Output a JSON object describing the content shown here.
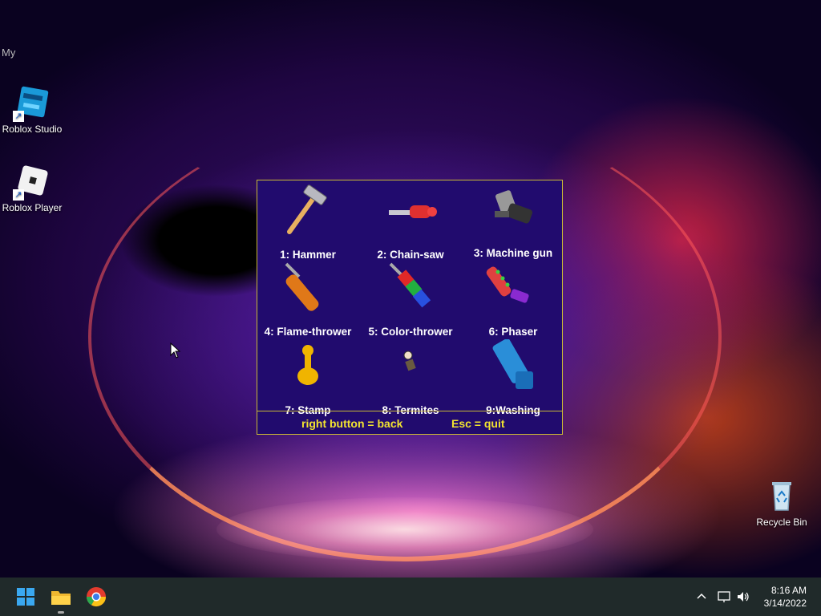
{
  "desktop": {
    "stray_text": "My",
    "icons": [
      {
        "label": "Roblox Studio",
        "icon": "roblox-studio-icon"
      },
      {
        "label": "Roblox Player",
        "icon": "roblox-player-icon"
      },
      {
        "label": "Recycle Bin",
        "icon": "recycle-bin-icon"
      }
    ]
  },
  "tool_menu": {
    "tools": [
      {
        "label": "1: Hammer",
        "icon": "hammer-icon"
      },
      {
        "label": "2: Chain-saw",
        "icon": "chainsaw-icon"
      },
      {
        "label": "3: Machine gun",
        "icon": "machine-gun-icon"
      },
      {
        "label": "4: Flame-thrower",
        "icon": "flamethrower-icon"
      },
      {
        "label": "5: Color-thrower",
        "icon": "color-thrower-icon"
      },
      {
        "label": "6: Phaser",
        "icon": "phaser-icon"
      },
      {
        "label": "7: Stamp",
        "icon": "stamp-icon"
      },
      {
        "label": "8: Termites",
        "icon": "termites-icon"
      },
      {
        "label": "9:Washing",
        "icon": "washing-icon"
      }
    ],
    "footer_back": "right button = back",
    "footer_quit": "Esc = quit",
    "colors": {
      "background": "#210b6e",
      "border": "#c9b836",
      "footer_text": "#f2e330"
    }
  },
  "taskbar": {
    "apps": [
      "start-icon",
      "file-explorer-icon",
      "chrome-icon"
    ],
    "tray": [
      "chevron-up-icon",
      "network-icon",
      "volume-icon"
    ],
    "time": "8:16 AM",
    "date": "3/14/2022"
  }
}
